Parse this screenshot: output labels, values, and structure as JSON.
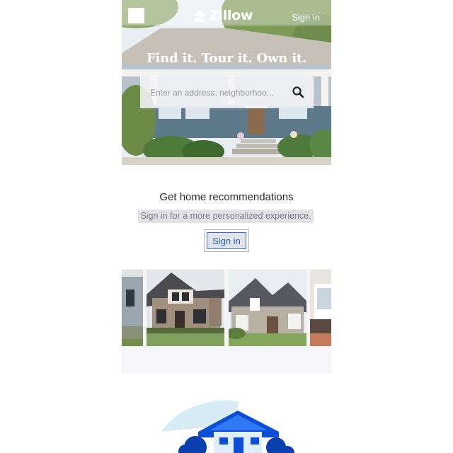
{
  "header": {
    "logo_text": "Zillow",
    "sign_in_label": "Sign in"
  },
  "hero": {
    "headline": "Find it. Tour it. Own it.",
    "search_placeholder": "Enter an address, neighborhoo..."
  },
  "recommendations": {
    "title": "Get home recommendations",
    "subtitle": "Sign in for a more personalized experience.",
    "button_label": "Sign in"
  },
  "icons": {
    "menu": "hamburger-menu-icon",
    "logo": "zillow-logo-icon",
    "search": "search-icon"
  },
  "colors": {
    "brand_blue": "#1f63d8",
    "illustration_blue": "#0c4fd6",
    "text_dark": "#2a2a33",
    "text_muted": "#7b7b85"
  }
}
